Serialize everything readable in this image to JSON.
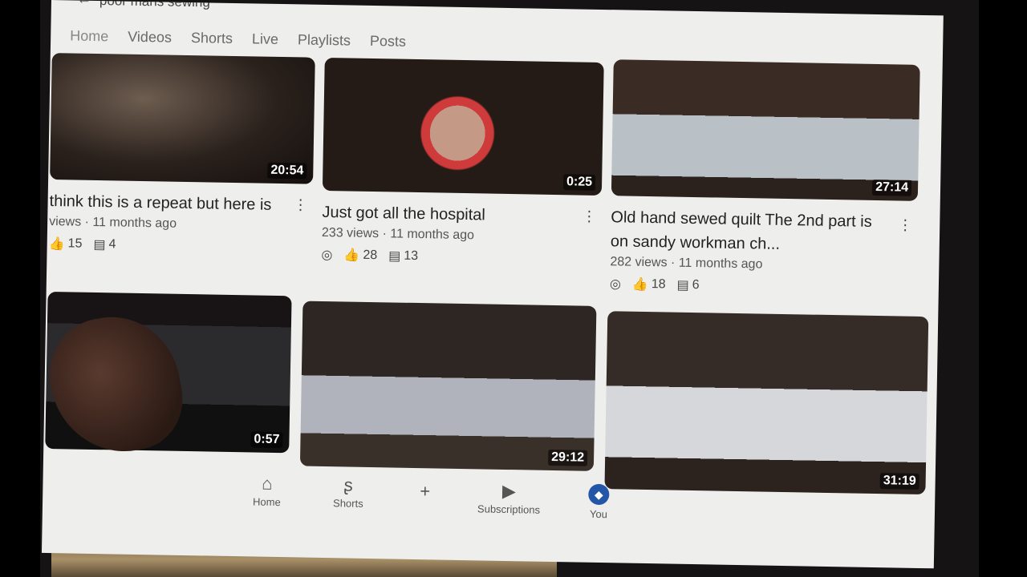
{
  "channel_search": "poor mans sewing",
  "tabs": [
    {
      "label": "Home"
    },
    {
      "label": "Videos"
    },
    {
      "label": "Shorts"
    },
    {
      "label": "Live"
    },
    {
      "label": "Playlists"
    },
    {
      "label": "Posts"
    }
  ],
  "videos": [
    {
      "title": "think this is a repeat but here is",
      "duration": "20:54",
      "views": "views",
      "age": "11 months ago",
      "likes": "15",
      "comments": "4"
    },
    {
      "title": "Just got all the hospital",
      "duration": "0:25",
      "views": "233 views",
      "age": "11 months ago",
      "likes": "28",
      "comments": "13"
    },
    {
      "title": "Old hand sewed quilt The 2nd part is on sandy workman ch...",
      "duration": "27:14",
      "views": "282 views",
      "age": "11 months ago",
      "likes": "18",
      "comments": "6"
    },
    {
      "duration": "0:57"
    },
    {
      "duration": "29:12"
    },
    {
      "duration": "31:19"
    }
  ],
  "bottom_nav": [
    {
      "label": "Home",
      "icon": "home-icon"
    },
    {
      "label": "Shorts",
      "icon": "shorts-icon"
    },
    {
      "label": "",
      "icon": "plus-icon"
    },
    {
      "label": "Subscriptions",
      "icon": "subscriptions-icon"
    },
    {
      "label": "You",
      "icon": "you-avatar-icon"
    }
  ],
  "colors": {
    "screen_bg": "#eeeeed",
    "avatar": "#2456a8"
  }
}
